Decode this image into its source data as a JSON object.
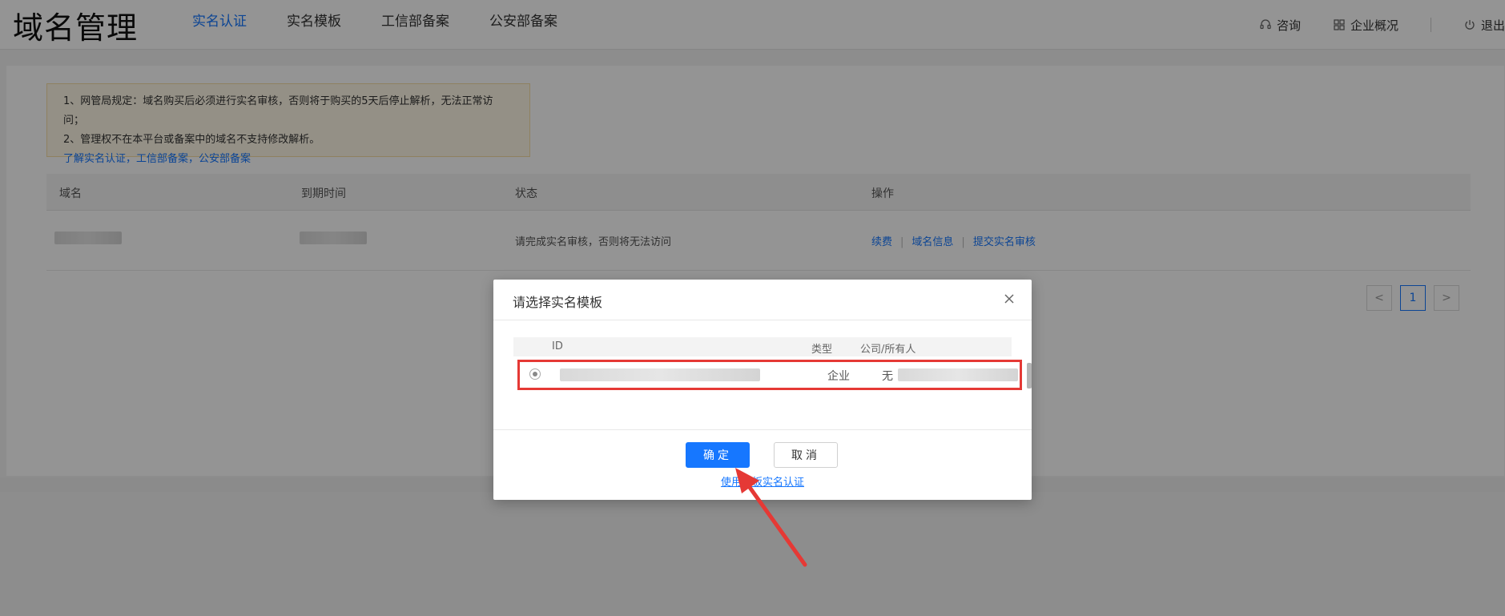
{
  "header": {
    "brand": "域名管理",
    "nav": [
      "实名认证",
      "实名模板",
      "工信部备案",
      "公安部备案"
    ],
    "active_nav": 0,
    "right_links": {
      "consult": "咨询",
      "overview": "企业概况",
      "logout": "退出"
    }
  },
  "notice": {
    "line1": "1、网管局规定：域名购买后必须进行实名审核，否则将于购买的5天后停止解析，无法正常访问；",
    "line2": "2、管理权不在本平台或备案中的域名不支持修改解析。",
    "link": "了解实名认证，工信部备案，公安部备案"
  },
  "table": {
    "columns": {
      "domain": "域名",
      "expire": "到期时间",
      "status": "状态",
      "ops": "操作"
    },
    "row": {
      "status": "请完成实名审核，否则将无法访问",
      "ops": [
        "续费",
        "域名信息",
        "提交实名审核"
      ]
    }
  },
  "pager": {
    "prev": "<",
    "page": "1",
    "next": ">"
  },
  "modal": {
    "title": "请选择实名模板",
    "columns": {
      "id": "ID",
      "type": "类型",
      "owner": "公司/所有人"
    },
    "row": {
      "type": "企业",
      "owner_prefix": "无"
    },
    "ok": "确定",
    "cancel": "取消",
    "link": "使用模板实名认证"
  },
  "colors": {
    "accent": "#1677ff",
    "highlight": "#e53935",
    "notice_bg": "#fff8e7"
  }
}
